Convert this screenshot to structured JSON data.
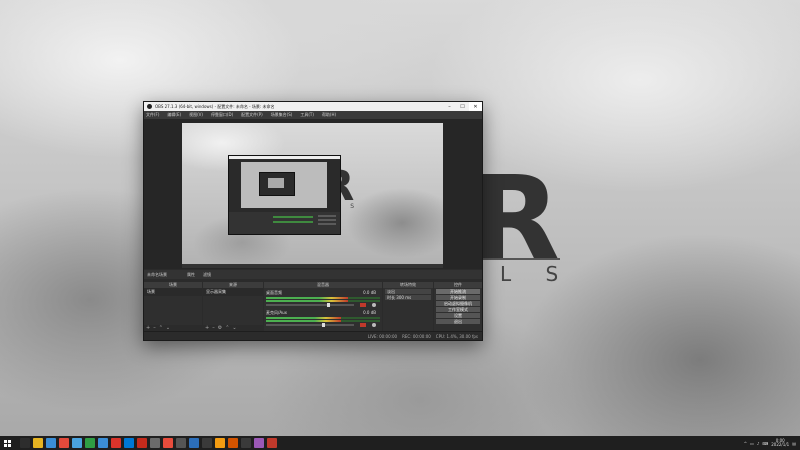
{
  "wallpaper": {
    "logo_letter": "R",
    "logo_sub": "L S"
  },
  "obs": {
    "title": "OBS 27.1.3 (64-bit, windows) - 配置文件: 未命名 - 场景: 未命名",
    "menu": [
      "文件(F)",
      "编辑(E)",
      "视图(V)",
      "停靠窗口(D)",
      "配置文件(P)",
      "场景集合(S)",
      "工具(T)",
      "帮助(H)"
    ],
    "current_scene_label": "未命名场景",
    "tool_properties": "属性",
    "tool_filters": "滤镜",
    "docks": {
      "scenes": "场景",
      "sources": "来源",
      "mixer": "混音器",
      "transitions": "转场特效",
      "controls": "控件"
    },
    "scenes_list": [
      "场景"
    ],
    "sources_list": [
      "显示器采集"
    ],
    "mixer_tracks": [
      {
        "name": "桌面音频",
        "db": "0.0 dB",
        "level": 0.72
      },
      {
        "name": "麦克风/Aux",
        "db": "0.0 dB",
        "level": 0.66
      }
    ],
    "transition": {
      "type": "淡出",
      "duration_label": "时长",
      "duration": "300 ms"
    },
    "controls": [
      "开始推流",
      "开始录制",
      "启动虚拟摄像机",
      "工作室模式",
      "设置",
      "退出"
    ],
    "status": [
      "LIVE: 00:00:00",
      "REC: 00:00:00",
      "CPU: 1.4%, 30.00 fps"
    ],
    "window_controls": {
      "minimize": "–",
      "maximize": "☐",
      "close": "✕"
    }
  },
  "preview": {
    "logo_letter": "R",
    "logo_sub": "L S"
  },
  "taskbar": {
    "icons": [
      "#2d2d2d",
      "#e6b422",
      "#3b8ed6",
      "#e24a3b",
      "#4aa3df",
      "#2f9e44",
      "#3b8ed6",
      "#d9342b",
      "#0078d4",
      "#c42b1c",
      "#6b6b6b",
      "#e74c3c",
      "#555555",
      "#2c6fbb",
      "#3a3a3a",
      "#f39c12",
      "#d35400",
      "#3a3a3a",
      "#9b59b6",
      "#c0392b"
    ],
    "time": "0:00",
    "date": "2022/1/1"
  }
}
